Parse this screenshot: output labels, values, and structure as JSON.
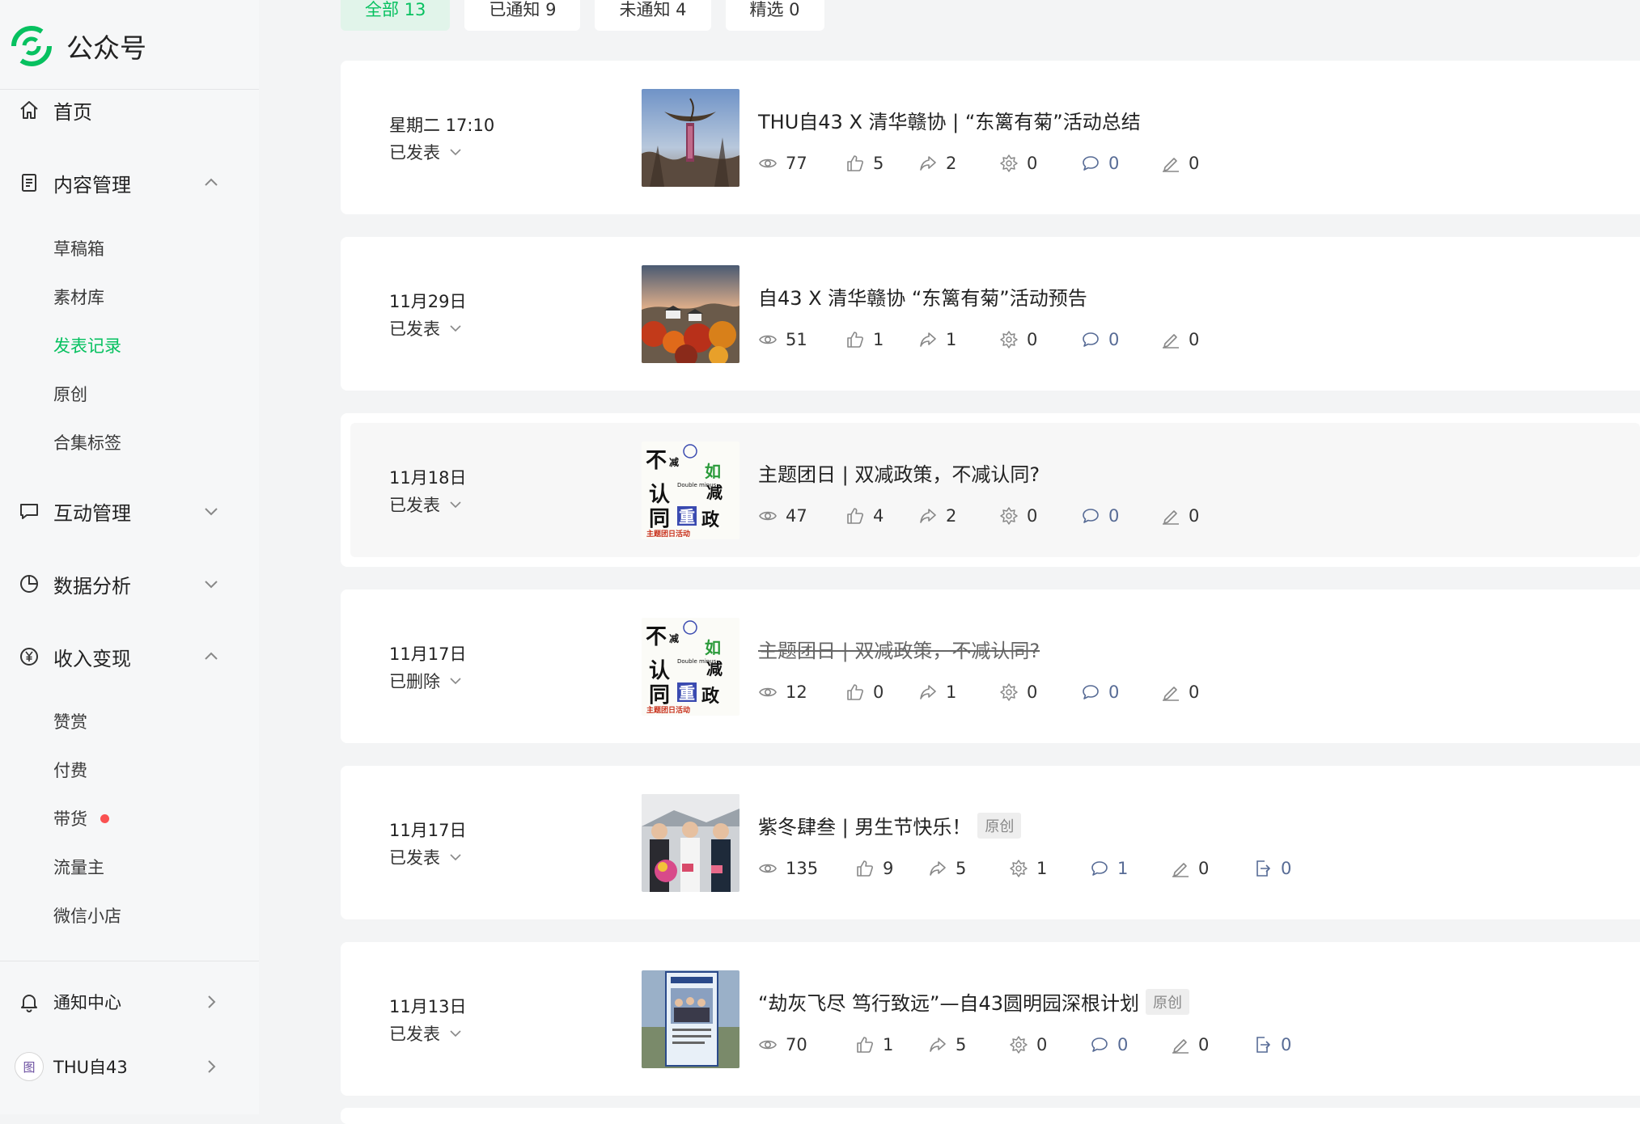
{
  "sidebar": {
    "brand": "公众号",
    "home": "首页",
    "content_mgmt": "内容管理",
    "content_sub": [
      "草稿箱",
      "素材库",
      "发表记录",
      "原创",
      "合集标签"
    ],
    "interaction": "互动管理",
    "analytics": "数据分析",
    "monetize": "收入变现",
    "monetize_sub": [
      "赞赏",
      "付费",
      "带货",
      "流量主",
      "微信小店"
    ],
    "notifications": "通知中心",
    "account": "THU自43",
    "account_avatar": "图"
  },
  "tabs": [
    {
      "label": "全部 13",
      "active": true
    },
    {
      "label": "已通知 9",
      "active": false
    },
    {
      "label": "未通知 4",
      "active": false
    },
    {
      "label": "精选 0",
      "active": false
    }
  ],
  "articles": [
    {
      "date": "星期二 17:10",
      "status": "已发表",
      "title": "THU自43 X 清华赣协 | “东篱有菊”活动总结",
      "deleted": false,
      "original_badge": "",
      "views": "77",
      "likes": "5",
      "shares": "2",
      "wow": "0",
      "comments": "0",
      "notes": "0",
      "reposts": ""
    },
    {
      "date": "11月29日",
      "status": "已发表",
      "title": "自43 X 清华赣协 “东篱有菊”活动预告",
      "deleted": false,
      "original_badge": "",
      "views": "51",
      "likes": "1",
      "shares": "1",
      "wow": "0",
      "comments": "0",
      "notes": "0",
      "reposts": ""
    },
    {
      "date": "11月18日",
      "status": "已发表",
      "title": "主题团日 | 双减政策，不减认同?",
      "deleted": false,
      "original_badge": "",
      "views": "47",
      "likes": "4",
      "shares": "2",
      "wow": "0",
      "comments": "0",
      "notes": "0",
      "reposts": ""
    },
    {
      "date": "11月17日",
      "status": "已删除",
      "title": "主题团日 | 双减政策，不减认同?",
      "deleted": true,
      "original_badge": "",
      "views": "12",
      "likes": "0",
      "shares": "1",
      "wow": "0",
      "comments": "0",
      "notes": "0",
      "reposts": ""
    },
    {
      "date": "11月17日",
      "status": "已发表",
      "title": "紫冬肆叁 | 男生节快乐！",
      "deleted": false,
      "original_badge": "原创",
      "views": "135",
      "likes": "9",
      "shares": "5",
      "wow": "1",
      "comments": "1",
      "notes": "0",
      "reposts": "0"
    },
    {
      "date": "11月13日",
      "status": "已发表",
      "title": "“劫灰飞尽 笃行致远”—自43圆明园深根计划",
      "deleted": false,
      "original_badge": "原创",
      "views": "70",
      "likes": "1",
      "shares": "5",
      "wow": "0",
      "comments": "0",
      "notes": "0",
      "reposts": "0"
    }
  ],
  "thumb_text": {
    "poster_big_1": "不",
    "poster_big_2": "认",
    "poster_big_3": "同",
    "poster_big_4": "重",
    "poster_big_5": "政",
    "poster_small_1": "减",
    "poster_small_2": "如",
    "poster_small_3": "减",
    "poster_en": "Double minus",
    "poster_footer": "主题团日活动"
  },
  "colors": {
    "accent": "#07c160",
    "link_blue": "#576b95",
    "red_dot": "#fa5151"
  }
}
